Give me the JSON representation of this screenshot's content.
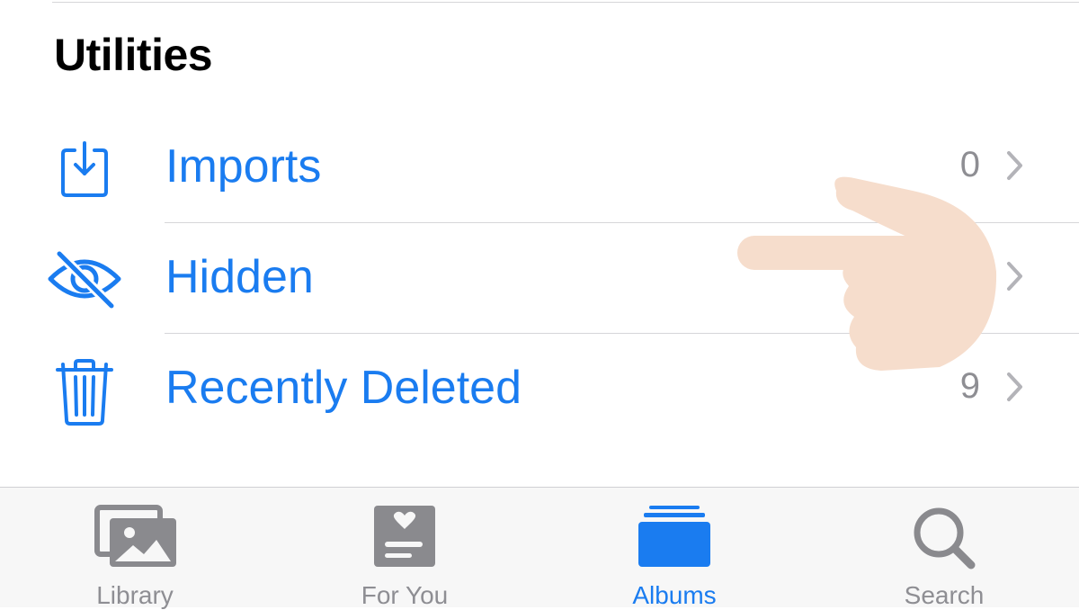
{
  "section": {
    "title": "Utilities"
  },
  "rows": [
    {
      "label": "Imports",
      "count": "0",
      "icon": "import-tray-icon"
    },
    {
      "label": "Hidden",
      "count": "",
      "icon": "eye-slash-icon"
    },
    {
      "label": "Recently Deleted",
      "count": "9",
      "icon": "trash-icon"
    }
  ],
  "tabbar": {
    "items": [
      {
        "label": "Library",
        "icon": "photo-library-icon",
        "active": false
      },
      {
        "label": "For You",
        "icon": "for-you-card-icon",
        "active": false
      },
      {
        "label": "Albums",
        "icon": "albums-stack-icon",
        "active": true
      },
      {
        "label": "Search",
        "icon": "search-icon",
        "active": false
      }
    ]
  },
  "colors": {
    "accent": "#1a7cf0",
    "secondary_text": "#8e8e93",
    "tab_inactive_icon": "#8a8a8e",
    "separator": "#d6d6d9",
    "tabbar_bg": "#f7f7f7",
    "finger_emoji": "#f6ddcc"
  },
  "overlay": {
    "icon": "pointing-finger-icon"
  }
}
